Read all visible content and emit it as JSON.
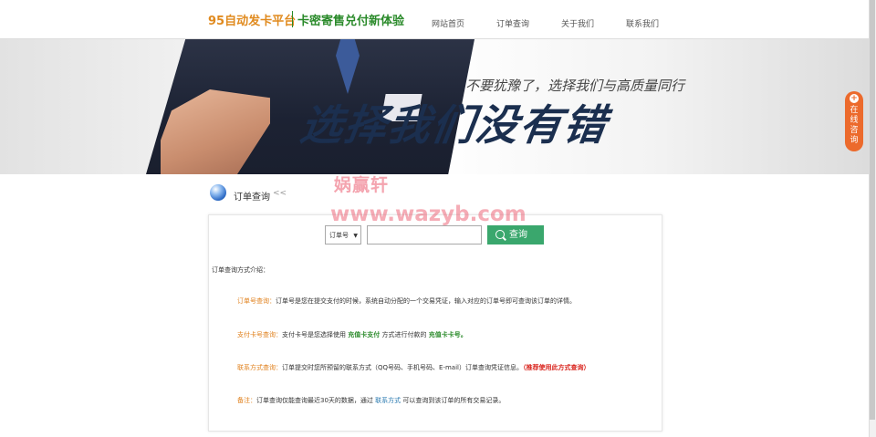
{
  "header": {
    "logo_primary": "95自动发卡平台",
    "logo_secondary": "卡密寄售兑付新体验",
    "nav": [
      {
        "label": "网站首页"
      },
      {
        "label": "订单查询"
      },
      {
        "label": "关于我们"
      },
      {
        "label": "联系我们"
      }
    ]
  },
  "banner": {
    "tagline": "不要犹豫了，选择我们与高质量同行",
    "headline": "选择我们没有错"
  },
  "side_consult": {
    "label": "在线咨询"
  },
  "section": {
    "title": "订单查询",
    "arrows": "<<"
  },
  "search": {
    "select_value": "订单号",
    "input_value": "",
    "button_label": "查询"
  },
  "intro": {
    "title": "订单查询方式介绍：",
    "items": [
      {
        "label": "订单号查询：",
        "text": "订单号是您在提交支付的时候，系统自动分配的一个交易凭证，输入对应的订单号即可查询该订单的详情。"
      },
      {
        "label": "支付卡号查询：",
        "text_a": "支付卡号是您选择使用",
        "link_a": "充值卡支付",
        "text_b": "方式进行付款的",
        "link_b": "充值卡卡号。"
      },
      {
        "label": "联系方式查询：",
        "text": "订单提交时您所预留的联系方式（QQ号码、手机号码、E-mail）订单查询凭证信息。",
        "note": "（推荐使用此方式查询）"
      },
      {
        "label": "备注：",
        "text_a": "订单查询仅能查询最近30天的数据，通过",
        "link": "联系方式",
        "text_b": "可以查询到该订单的所有交易记录。"
      }
    ]
  },
  "watermark": {
    "line1": "娲赢轩",
    "line2": "www.wazyb.com"
  },
  "colors": {
    "brand_orange": "#e08a1e",
    "brand_green": "#2a8a2a",
    "button_green": "#3aa76d",
    "consult_orange": "#ec6a2c",
    "note_red": "#d9231c"
  }
}
